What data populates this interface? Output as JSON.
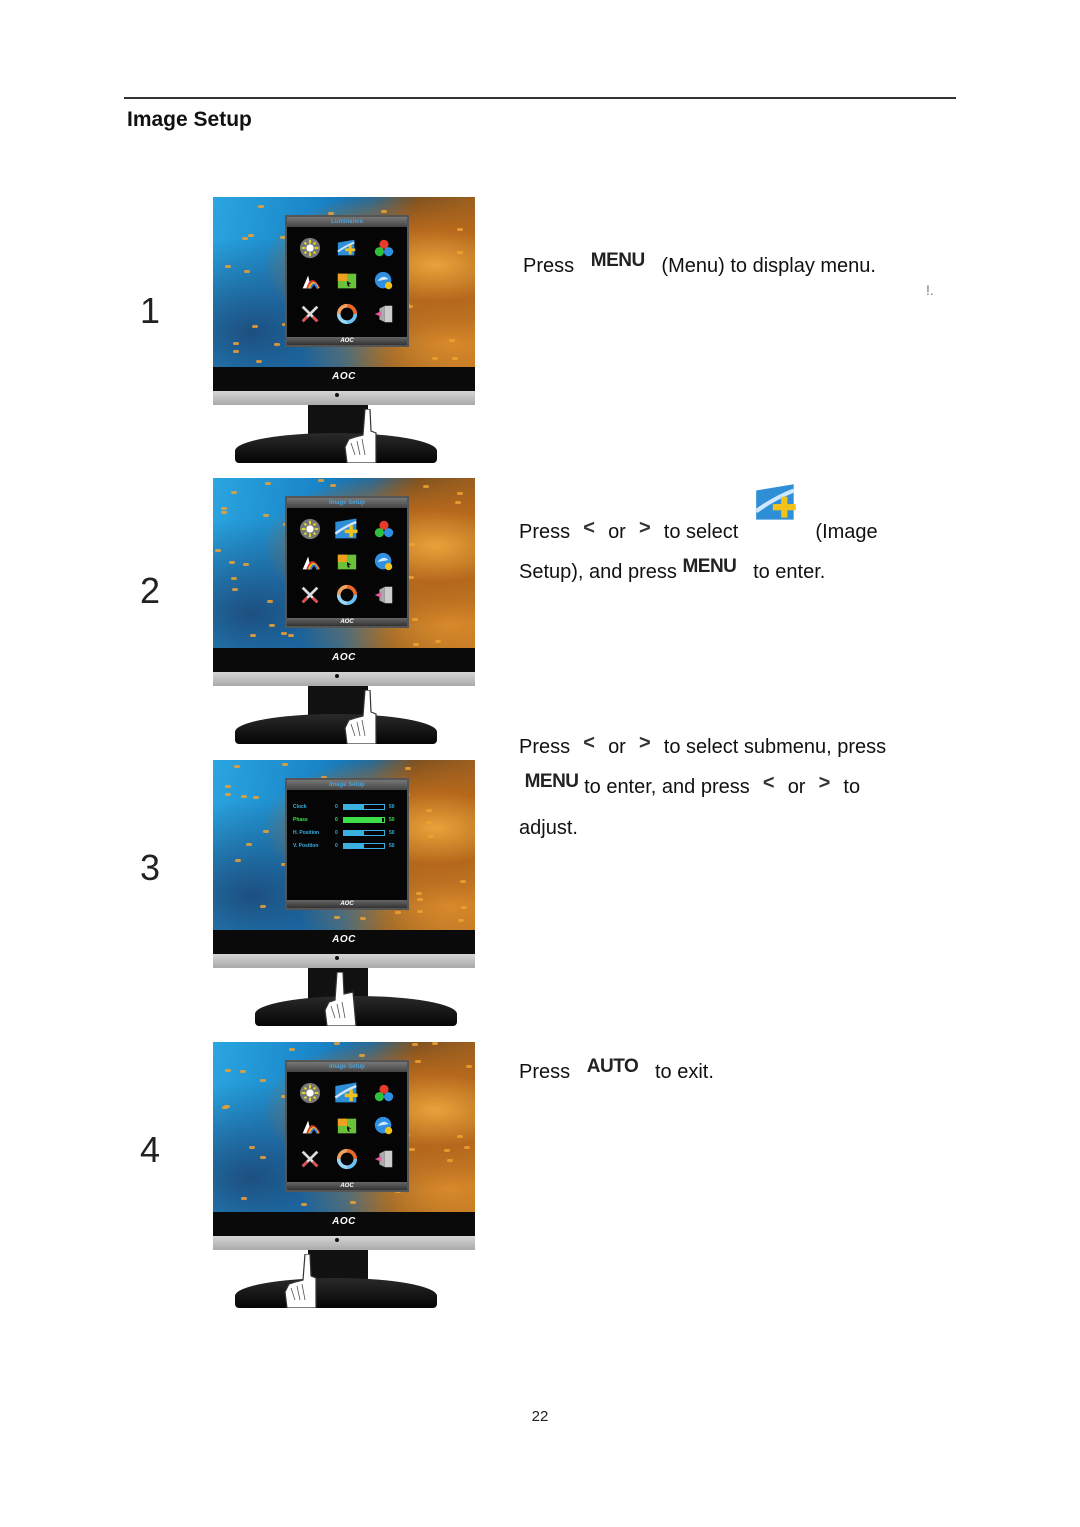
{
  "section": {
    "title": "Image Setup"
  },
  "steps": [
    {
      "number": "1",
      "osd_title": "Luminance",
      "brand": "AOC",
      "instruction": {
        "press": "Press",
        "key": "MENU",
        "rest": "(Menu) to display menu."
      }
    },
    {
      "number": "2",
      "osd_title": "Image Setup",
      "brand": "AOC",
      "instruction": {
        "press": "Press",
        "left_arrow": "<",
        "or": "or",
        "right_arrow": ">",
        "to_select": "to select",
        "icon": "image-setup-icon",
        "label_open": "(Image",
        "label_close": "Setup), and press",
        "key": "MENU",
        "rest": "to enter."
      }
    },
    {
      "number": "3",
      "osd_title": "Image Setup",
      "brand": "AOC",
      "submenu": [
        {
          "label": "Clock",
          "min": "0",
          "value": 50,
          "max_label": "50",
          "active": false
        },
        {
          "label": "Phase",
          "min": "0",
          "value": 50,
          "max_label": "50",
          "active": true
        },
        {
          "label": "H. Position",
          "min": "0",
          "value": 50,
          "max_label": "50",
          "active": false
        },
        {
          "label": "V. Position",
          "min": "0",
          "value": 50,
          "max_label": "50",
          "active": false
        }
      ],
      "instruction": {
        "press": "Press",
        "left_arrow": "<",
        "or": "or",
        "right_arrow": ">",
        "to_select": "to select submenu, press",
        "key": "MENU",
        "mid": "to enter, and press",
        "or2": "or",
        "to": "to",
        "end": "adjust."
      }
    },
    {
      "number": "4",
      "osd_title": "Image Setup",
      "brand": "AOC",
      "instruction": {
        "press": "Press",
        "key": "AUTO",
        "rest": "to exit."
      }
    }
  ],
  "monitor_buttons": [
    "AUTO",
    "<",
    ">",
    "MENU",
    "O"
  ],
  "osd_menu_icons": [
    "luminance-icon",
    "image-setup-icon",
    "color-temp-icon",
    "color-boost-icon",
    "picture-boost-icon",
    "osd-setup-icon",
    "extra-icon",
    "reset-icon",
    "exit-icon"
  ],
  "page": {
    "number": "22"
  }
}
